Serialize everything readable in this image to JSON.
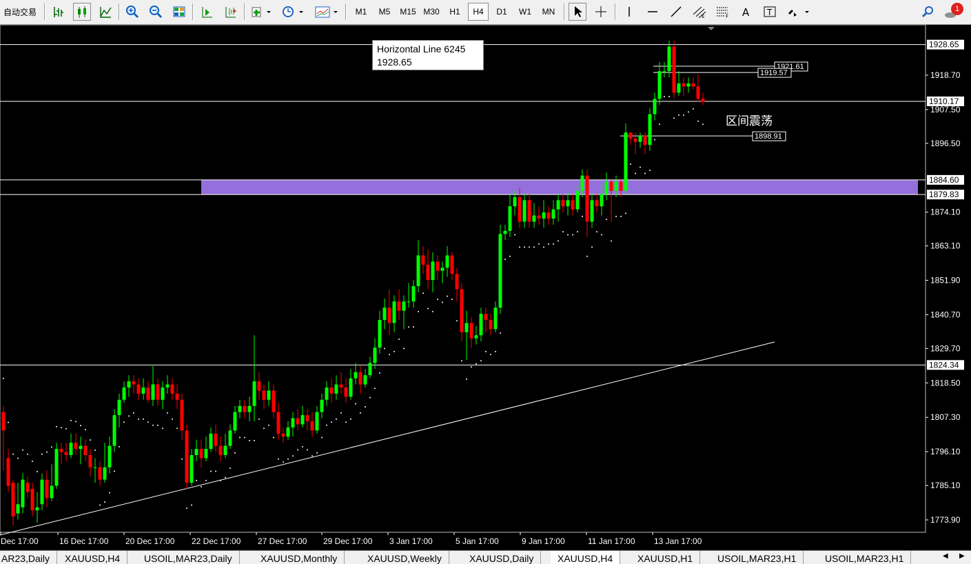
{
  "toolbar": {
    "auto_trading_label": "自动交易",
    "timeframes": [
      "M1",
      "M5",
      "M15",
      "M30",
      "H1",
      "H4",
      "D1",
      "W1",
      "MN"
    ],
    "active_timeframe": "H4",
    "notification_count": "1"
  },
  "chart": {
    "symbol": "XAUUSD",
    "period": "H4",
    "price_axis": {
      "min": 1768.4,
      "max": 1932.0,
      "labels": [
        "1918.70",
        "1907.50",
        "1896.50",
        "1874.10",
        "1863.10",
        "1851.90",
        "1840.70",
        "1829.70",
        "1818.50",
        "1807.30",
        "1796.10",
        "1785.10",
        "1773.90"
      ]
    },
    "time_axis": [
      "Dec 17:00",
      "16 Dec 17:00",
      "20 Dec 17:00",
      "22 Dec 17:00",
      "27 Dec 17:00",
      "29 Dec 17:00",
      "3 Jan 17:00",
      "5 Jan 17:00",
      "9 Jan 17:00",
      "11 Jan 17:00",
      "13 Jan 17:00"
    ],
    "horizontal_lines": [
      {
        "price": 1928.65,
        "label": "1928.65"
      },
      {
        "price": 1910.17,
        "label": "1910.17"
      },
      {
        "price": 1884.6,
        "label": "1884.60"
      },
      {
        "price": 1879.83,
        "label": "1879.83"
      },
      {
        "price": 1824.34,
        "label": "1824.34"
      }
    ],
    "price_tags": [
      {
        "price": 1921.61,
        "label": "1921.61"
      },
      {
        "price": 1919.57,
        "label": "1919.57"
      },
      {
        "price": 1898.91,
        "label": "1898.91"
      }
    ],
    "zone": {
      "top": 1884.6,
      "bottom": 1879.83,
      "color": "#9370db"
    },
    "tooltip": {
      "name": "Horizontal Line 6245",
      "value": "1928.65"
    },
    "annotation": "区间震荡",
    "colors": {
      "bull": "#00ff00",
      "bear": "#ff0000",
      "background": "#000000",
      "foreground": "#ffffff",
      "zone": "#9370db"
    }
  },
  "tabs": [
    "AR23,Daily",
    "XAUUSD,H4",
    "USOIL,MAR23,Daily",
    "XAUUSD,Monthly",
    "XAUUSD,Weekly",
    "XAUUSD,Daily",
    "XAUUSD,H4",
    "XAUUSD,H1",
    "USOIL,MAR23,H1",
    "USOIL,MAR23,H1"
  ],
  "active_tab_index": 6,
  "candles": [
    [
      1809,
      1803,
      1811,
      1790
    ],
    [
      1794,
      1785,
      1797,
      1783
    ],
    [
      1786,
      1775,
      1787,
      1772
    ],
    [
      1776,
      1779,
      1786,
      1774
    ],
    [
      1778,
      1787,
      1789,
      1776
    ],
    [
      1786,
      1783,
      1788,
      1781
    ],
    [
      1784,
      1777,
      1786,
      1775
    ],
    [
      1777,
      1778,
      1783,
      1773
    ],
    [
      1779,
      1787,
      1789,
      1777
    ],
    [
      1787,
      1781,
      1790,
      1778
    ],
    [
      1781,
      1785,
      1792,
      1780
    ],
    [
      1785,
      1797,
      1799,
      1784
    ],
    [
      1797,
      1796,
      1799,
      1792
    ],
    [
      1796,
      1795,
      1799,
      1793
    ],
    [
      1795,
      1799,
      1802,
      1794
    ],
    [
      1799,
      1797,
      1802,
      1795
    ],
    [
      1797,
      1798,
      1801,
      1792
    ],
    [
      1798,
      1795,
      1800,
      1793
    ],
    [
      1795,
      1791,
      1797,
      1788
    ],
    [
      1791,
      1791,
      1794,
      1786
    ],
    [
      1791,
      1787,
      1793,
      1785
    ],
    [
      1787,
      1791,
      1799,
      1786
    ],
    [
      1791,
      1798,
      1801,
      1789
    ],
    [
      1798,
      1808,
      1810,
      1796
    ],
    [
      1808,
      1813,
      1815,
      1804
    ],
    [
      1813,
      1817,
      1819,
      1812
    ],
    [
      1817,
      1819,
      1821,
      1814
    ],
    [
      1819,
      1818,
      1821,
      1815
    ],
    [
      1818,
      1815,
      1820,
      1813
    ],
    [
      1815,
      1817,
      1820,
      1813
    ],
    [
      1817,
      1813,
      1819,
      1812
    ],
    [
      1813,
      1818,
      1824,
      1811
    ],
    [
      1818,
      1813,
      1820,
      1811
    ],
    [
      1813,
      1817,
      1819,
      1810
    ],
    [
      1817,
      1818,
      1821,
      1815
    ],
    [
      1818,
      1815,
      1820,
      1813
    ],
    [
      1815,
      1813,
      1818,
      1810
    ],
    [
      1813,
      1803,
      1815,
      1800
    ],
    [
      1803,
      1786,
      1805,
      1784
    ],
    [
      1786,
      1795,
      1797,
      1785
    ],
    [
      1795,
      1797,
      1800,
      1793
    ],
    [
      1797,
      1794,
      1800,
      1791
    ],
    [
      1794,
      1797,
      1801,
      1793
    ],
    [
      1797,
      1802,
      1804,
      1796
    ],
    [
      1802,
      1798,
      1805,
      1796
    ],
    [
      1798,
      1795,
      1801,
      1793
    ],
    [
      1795,
      1798,
      1802,
      1794
    ],
    [
      1798,
      1803,
      1805,
      1797
    ],
    [
      1803,
      1809,
      1811,
      1802
    ],
    [
      1809,
      1811,
      1813,
      1807
    ],
    [
      1811,
      1809,
      1813,
      1807
    ],
    [
      1809,
      1811,
      1814,
      1806
    ],
    [
      1811,
      1819,
      1834,
      1806
    ],
    [
      1819,
      1816,
      1822,
      1813
    ],
    [
      1816,
      1813,
      1818,
      1810
    ],
    [
      1813,
      1816,
      1819,
      1811
    ],
    [
      1816,
      1809,
      1818,
      1807
    ],
    [
      1809,
      1802,
      1812,
      1800
    ],
    [
      1802,
      1801,
      1804,
      1799
    ],
    [
      1801,
      1804,
      1806,
      1800
    ],
    [
      1804,
      1807,
      1809,
      1801
    ],
    [
      1807,
      1805,
      1810,
      1803
    ],
    [
      1805,
      1808,
      1811,
      1804
    ],
    [
      1808,
      1806,
      1810,
      1803
    ],
    [
      1806,
      1803,
      1809,
      1801
    ],
    [
      1803,
      1809,
      1811,
      1802
    ],
    [
      1809,
      1813,
      1815,
      1807
    ],
    [
      1813,
      1817,
      1819,
      1811
    ],
    [
      1817,
      1815,
      1820,
      1812
    ],
    [
      1815,
      1818,
      1821,
      1813
    ],
    [
      1818,
      1817,
      1822,
      1815
    ],
    [
      1817,
      1814,
      1820,
      1812
    ],
    [
      1814,
      1820,
      1823,
      1813
    ],
    [
      1820,
      1822,
      1825,
      1818
    ],
    [
      1822,
      1818,
      1824,
      1815
    ],
    [
      1818,
      1821,
      1823,
      1817
    ],
    [
      1821,
      1825,
      1827,
      1820
    ],
    [
      1825,
      1830,
      1833,
      1823
    ],
    [
      1830,
      1839,
      1842,
      1828
    ],
    [
      1839,
      1843,
      1846,
      1836
    ],
    [
      1843,
      1838,
      1849,
      1834
    ],
    [
      1838,
      1845,
      1847,
      1835
    ],
    [
      1845,
      1842,
      1849,
      1839
    ],
    [
      1842,
      1845,
      1847,
      1836
    ],
    [
      1845,
      1845,
      1851,
      1843
    ],
    [
      1845,
      1850,
      1852,
      1843
    ],
    [
      1850,
      1860,
      1865,
      1848
    ],
    [
      1860,
      1857,
      1863,
      1854
    ],
    [
      1857,
      1852,
      1862,
      1849
    ],
    [
      1852,
      1858,
      1861,
      1848
    ],
    [
      1858,
      1855,
      1860,
      1852
    ],
    [
      1855,
      1856,
      1858,
      1851
    ],
    [
      1856,
      1860,
      1863,
      1853
    ],
    [
      1860,
      1854,
      1861,
      1852
    ],
    [
      1854,
      1849,
      1856,
      1845
    ],
    [
      1849,
      1835,
      1851,
      1832
    ],
    [
      1835,
      1838,
      1842,
      1826
    ],
    [
      1838,
      1833,
      1840,
      1830
    ],
    [
      1833,
      1834,
      1837,
      1831
    ],
    [
      1834,
      1841,
      1843,
      1832
    ],
    [
      1841,
      1839,
      1843,
      1835
    ],
    [
      1839,
      1836,
      1841,
      1834
    ],
    [
      1836,
      1843,
      1845,
      1835
    ],
    [
      1843,
      1867,
      1870,
      1841
    ],
    [
      1867,
      1868,
      1870,
      1865
    ],
    [
      1868,
      1876,
      1880,
      1866
    ],
    [
      1876,
      1879,
      1881,
      1873
    ],
    [
      1879,
      1871,
      1882,
      1869
    ],
    [
      1871,
      1878,
      1880,
      1869
    ],
    [
      1878,
      1871,
      1880,
      1869
    ],
    [
      1871,
      1873,
      1877,
      1869
    ],
    [
      1873,
      1872,
      1876,
      1870
    ],
    [
      1872,
      1874,
      1878,
      1869
    ],
    [
      1874,
      1872,
      1876,
      1870
    ],
    [
      1872,
      1875,
      1878,
      1870
    ],
    [
      1875,
      1878,
      1880,
      1871
    ],
    [
      1878,
      1876,
      1880,
      1874
    ],
    [
      1876,
      1878,
      1881,
      1873
    ],
    [
      1878,
      1875,
      1880,
      1873
    ],
    [
      1875,
      1881,
      1883,
      1874
    ],
    [
      1881,
      1886,
      1888,
      1879
    ],
    [
      1886,
      1871,
      1888,
      1866
    ],
    [
      1871,
      1878,
      1880,
      1869
    ],
    [
      1878,
      1876,
      1880,
      1874
    ],
    [
      1876,
      1880,
      1883,
      1873
    ],
    [
      1880,
      1884,
      1887,
      1878
    ],
    [
      1884,
      1881,
      1885,
      1871
    ],
    [
      1881,
      1884,
      1886,
      1879
    ],
    [
      1884,
      1881,
      1885,
      1879
    ],
    [
      1881,
      1900,
      1903,
      1880
    ],
    [
      1900,
      1898,
      1900,
      1896
    ],
    [
      1898,
      1897,
      1900,
      1893
    ],
    [
      1897,
      1899,
      1900,
      1895
    ],
    [
      1899,
      1896,
      1900,
      1893
    ],
    [
      1896,
      1906,
      1908,
      1894
    ],
    [
      1906,
      1911,
      1913,
      1904
    ],
    [
      1911,
      1920,
      1923,
      1909
    ],
    [
      1920,
      1920,
      1923,
      1918
    ],
    [
      1920,
      1928,
      1930,
      1918
    ],
    [
      1928,
      1913,
      1930,
      1911
    ],
    [
      1913,
      1916,
      1920,
      1912
    ],
    [
      1916,
      1915,
      1918,
      1912
    ],
    [
      1915,
      1916,
      1918,
      1913
    ],
    [
      1916,
      1915,
      1918,
      1914
    ],
    [
      1915,
      1911,
      1919,
      1910
    ],
    [
      1911,
      1910,
      1913,
      1909
    ]
  ]
}
